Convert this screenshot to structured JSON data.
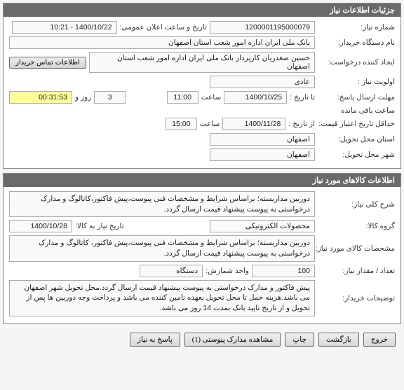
{
  "sections": {
    "need_info": {
      "title": "جزئیات اطلاعات نیاز"
    },
    "general": {
      "title": "شرح کلی نیاز"
    },
    "goods_info": {
      "title": "اطلاعات کالاهای مورد نیاز"
    }
  },
  "labels": {
    "need_no": "شماره نیاز:",
    "announce_dt": "تاریخ و ساعت اعلان عمومی:",
    "buyer_org": "نام دستگاه خریدار:",
    "requester": "ایجاد کننده درخواست:",
    "contact_btn": "اطلاعات تماس خریدار",
    "priority": "اولویت نیاز :",
    "reply_deadline": "مهلت ارسال پاسخ:",
    "to_date": "تا تاریخ :",
    "from_date": "از تاریخ :",
    "hour": "ساعت",
    "days_and": "روز و",
    "hours_left": "ساعت باقی مانده",
    "price_min_validity": "حداقل تاریخ اعتبار قیمت:",
    "delivery_province": "استان محل تحویل:",
    "delivery_city": "شهر محل تحویل:",
    "need_desc": "شرح کلی نیاز:",
    "goods_group": "گروه کالا:",
    "goods_date": "تاریخ نیاز به کالا:",
    "goods_spec": "مشخصات کالای مورد نیاز:",
    "qty": "تعداد / مقدار نیاز:",
    "order_unit": "واحد شمارش:",
    "buyer_notes": "توضیحات خریدار:"
  },
  "values": {
    "need_no": "1200001195000079",
    "announce_dt": "1400/10/22 - 10:21",
    "buyer_org": "بانک ملی ایران اداره امور شعب استان اصفهان",
    "requester": "حسین صغدریان کارپرداز بانک ملی ایران اداره امور شعب استان اصفهان",
    "priority": "عادی",
    "reply_to_date": "1400/10/25",
    "reply_hour": "11:00",
    "days_left": "3",
    "time_left": "00:31:53",
    "price_from_date": "1400/11/28",
    "price_hour": "15:00",
    "province": "اصفهان",
    "city": "اصفهان",
    "need_desc": "دوربین مداربسته؛ براساس شرایط و مشخصات فنی پیوست،پیش فاکتور،کاتالوگ و مدارک درخواستی به پیوست پیشنهاد قیمت ارسال گردد.",
    "goods_group": "محصولات الکترونیکی",
    "goods_date": "1400/10/28",
    "goods_spec": "دوربین مداربسته؛ براساس شرایط و مشخصات فنی پیوست،پیش فاکتور، کاتالوگ و مدارک درخواستی به پیوست پیشنهاد قیمت ارسال گردد.",
    "qty": "100",
    "order_unit": "دستگاه",
    "buyer_notes": "پیش فاکتور و مدارک درخواستی به پیوست پیشنهاد قیمت ارسال گردد.محل تحویل شهر اصفهان می باشد.هزینه حمل تا محل تحویل بعهده تامین کننده می باشد و پرداخت وجه دوربین ها پس از تحویل و از تاریخ تایید بانک بمدت 14 روز می باشد."
  },
  "buttons": {
    "reply": "پاسخ به نیاز",
    "attachments": "مشاهده مدارک پیوستی (1)",
    "print": "چاپ",
    "back": "بازگشت",
    "exit": "خروج"
  }
}
